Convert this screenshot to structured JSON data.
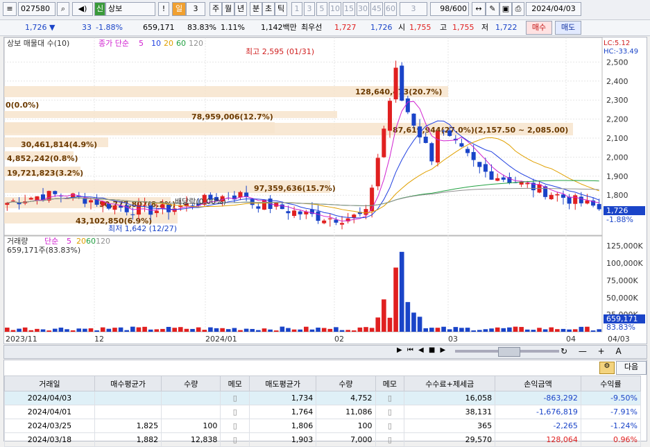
{
  "toolbar": {
    "code": "027580",
    "type_badge": "신",
    "name": "상보",
    "period_day": "일",
    "period_num": "3",
    "periods": [
      "주",
      "월",
      "년",
      "분",
      "초",
      "틱"
    ],
    "nums": [
      "1",
      "3",
      "5",
      "10",
      "15",
      "30",
      "45",
      "60"
    ],
    "num_sel": "3",
    "count": "98",
    "count_total": "/600",
    "date": "2024/04/03"
  },
  "quote": {
    "price": "1,726",
    "change": "33",
    "rate": "-1.88%",
    "volume": "659,171",
    "vol_ratio": "83.83%",
    "turnover": "1.11%",
    "amount": "1,142백만",
    "priority": "최우선",
    "bid1": "1,727",
    "bid2": "1,726",
    "open_label": "시",
    "open": "1,755",
    "high_label": "고",
    "high": "1,755",
    "low_label": "저",
    "low": "1,722",
    "buy_btn": "매수",
    "sell_btn": "매도"
  },
  "chart": {
    "legend_top": "상보 매물대 수(10)",
    "ma_label": "종가 단순",
    "ma_vals": [
      "5",
      "10",
      "20",
      "60",
      "120"
    ],
    "ma_colors": [
      "#d020d0",
      "#2040e0",
      "#e0a000",
      "#20a040",
      "#909090"
    ],
    "lc": "LC:5.12",
    "hc": "HC:-33.49",
    "price_tag": "1,726",
    "rate_tag": "-1.88%",
    "max_label": "최고 2,595 (01/31)",
    "min_label": "최저 1,642 (12/27)",
    "dividend": "배당락(0.00%)",
    "y_labels": [
      "2,500",
      "2,400",
      "2,300",
      "2,200",
      "2,100",
      "2,000",
      "1,900",
      "1,800"
    ],
    "vol_legend": "거래량",
    "vol_ma": "단순",
    "vol_ma_vals": [
      "5",
      "20",
      "60",
      "120"
    ],
    "vol_label": "659,171주(83.83%)",
    "vol_y": [
      "125,000K",
      "100,000K",
      "75,000K",
      "50,000K",
      "25,000K"
    ],
    "vol_tag": "659,171",
    "vol_pct": "83.83%",
    "x_labels": [
      "2023/11",
      "12",
      "2024/01",
      "02",
      "03",
      "04",
      "04/03"
    ],
    "profile": [
      {
        "t": "128,640,473(20.7%)"
      },
      {
        "t": "0(0.0%)"
      },
      {
        "t": "78,959,006(12.7%)"
      },
      {
        "t": "87,619,944(27.0%)(2,157.50 ~ 2,085.00)"
      },
      {
        "t": "30,461,814(4.9%)"
      },
      {
        "t": "4,852,242(0.8%)"
      },
      {
        "t": "19,721,823(3.2%)"
      },
      {
        "t": "97,359,636(15.7%)"
      },
      {
        "t": "50,777,807(8.2%)"
      },
      {
        "t": "43,102,850(6.9%)"
      }
    ]
  },
  "table": {
    "next": "다음",
    "headers": [
      "거래일",
      "매수평균가",
      "수량",
      "메모",
      "매도평균가",
      "수량",
      "메모",
      "수수료+제세금",
      "손익금액",
      "수익률"
    ],
    "rows": [
      [
        "2024/04/03",
        "",
        "",
        "",
        "1,734",
        "4,752",
        "",
        "16,058",
        "-863,292",
        "-9.50%"
      ],
      [
        "2024/04/01",
        "",
        "",
        "",
        "1,764",
        "11,086",
        "",
        "38,131",
        "-1,676,819",
        "-7.91%"
      ],
      [
        "2024/03/25",
        "1,825",
        "100",
        "",
        "1,806",
        "100",
        "",
        "365",
        "-2,265",
        "-1.24%"
      ],
      [
        "2024/03/18",
        "1,882",
        "12,838",
        "",
        "1,903",
        "7,000",
        "",
        "29,570",
        "128,064",
        "0.96%"
      ]
    ]
  }
}
